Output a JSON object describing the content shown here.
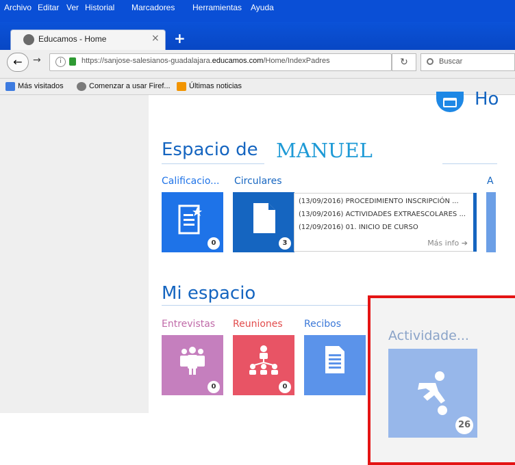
{
  "menu": [
    "Archivo",
    "Editar",
    "Ver",
    "Historial",
    "Marcadores",
    "Herramientas",
    "Ayuda"
  ],
  "tab": {
    "title": "Educamos - Home",
    "close": "×",
    "new_tab": "+"
  },
  "nav": {
    "url_prefix": "https://sanjose-salesianos-guadalajara.",
    "url_domain": "educamos.com",
    "url_path": "/Home/IndexPadres",
    "search_placeholder": "Buscar"
  },
  "bookmarks": [
    "Más visitados",
    "Comenzar a usar Firef...",
    "Últimas noticias"
  ],
  "header": {
    "partial_text": "Ho"
  },
  "espacio": {
    "title": "Espacio de",
    "name": "MANUEL",
    "tiles": [
      {
        "label": "Calificacio...",
        "count": "0",
        "color": "#1e73e8"
      },
      {
        "label": "Circulares",
        "count": "3",
        "color": "#1565c0"
      },
      {
        "label": "A"
      }
    ],
    "circulares": [
      "(13/09/2016) PROCEDIMIENTO INSCRIPCIÓN ...",
      "(13/09/2016) ACTIVIDADES EXTRAESCOLARES ...",
      "(12/09/2016) 01. INICIO DE CURSO"
    ],
    "mas_info": "Más info"
  },
  "mi_espacio": {
    "title": "Mi espacio",
    "tiles": [
      {
        "label": "Entrevistas",
        "count": "0",
        "color": "#c57fbe",
        "label_color": "#c06aa8"
      },
      {
        "label": "Reuniones",
        "count": "0",
        "color": "#e85465",
        "label_color": "#e24c4c"
      },
      {
        "label": "Recibos",
        "color": "#5b93ea",
        "label_color": "#3b78d8"
      },
      {
        "label": "Actividade...",
        "count": "26",
        "color": "#97b7ea",
        "label_color": "#8aa3c8"
      }
    ]
  },
  "colors": {
    "accent": "#1565c0",
    "highlight": "#e41414"
  }
}
